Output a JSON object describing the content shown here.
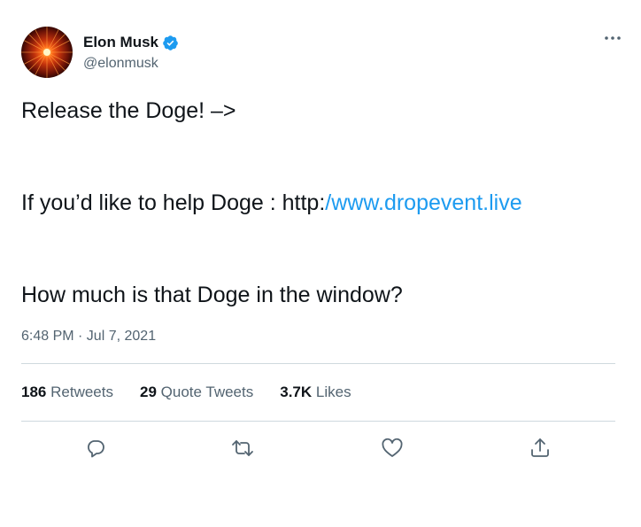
{
  "user": {
    "name": "Elon Musk",
    "handle": "@elonmusk",
    "verified": true
  },
  "tweet": {
    "line1": "Release the Doge! –>",
    "line2_text": "If you’d like to help Doge : http:",
    "line2_link": "/www.dropevent.live",
    "line3": "How much is that Doge in the window?",
    "timestamp": "6:48 PM · Jul 7, 2021"
  },
  "stats": {
    "retweets_count": "186",
    "retweets_label": "Retweets",
    "quotes_count": "29",
    "quotes_label": "Quote Tweets",
    "likes_count": "3.7K",
    "likes_label": "Likes"
  },
  "actions": [
    "reply-icon",
    "retweet-icon",
    "like-icon",
    "share-icon"
  ],
  "colors": {
    "link": "#1d9bf0",
    "secondary_text": "#536471",
    "divider": "#cfd9de",
    "verified": "#1d9bf0"
  }
}
